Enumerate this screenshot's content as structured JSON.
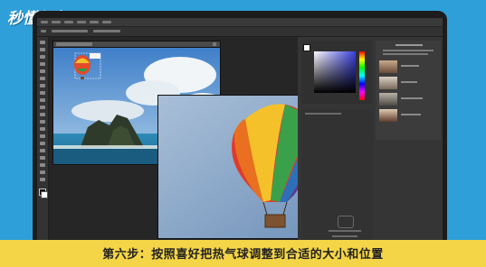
{
  "watermark": {
    "text": "秒懂视频"
  },
  "caption": {
    "text": "第六步：按照喜好把热气球调整到合适的大小和位置"
  },
  "colors": {
    "background": "#2e9fd8",
    "caption_bar": "#f5d548",
    "monitor_bezel": "#1c1c1c",
    "ps_ui": "#2b2b2b"
  },
  "icons": [
    "move-tool-icon",
    "marquee-tool-icon",
    "lasso-tool-icon",
    "brush-tool-icon",
    "zoom-tool-icon"
  ]
}
